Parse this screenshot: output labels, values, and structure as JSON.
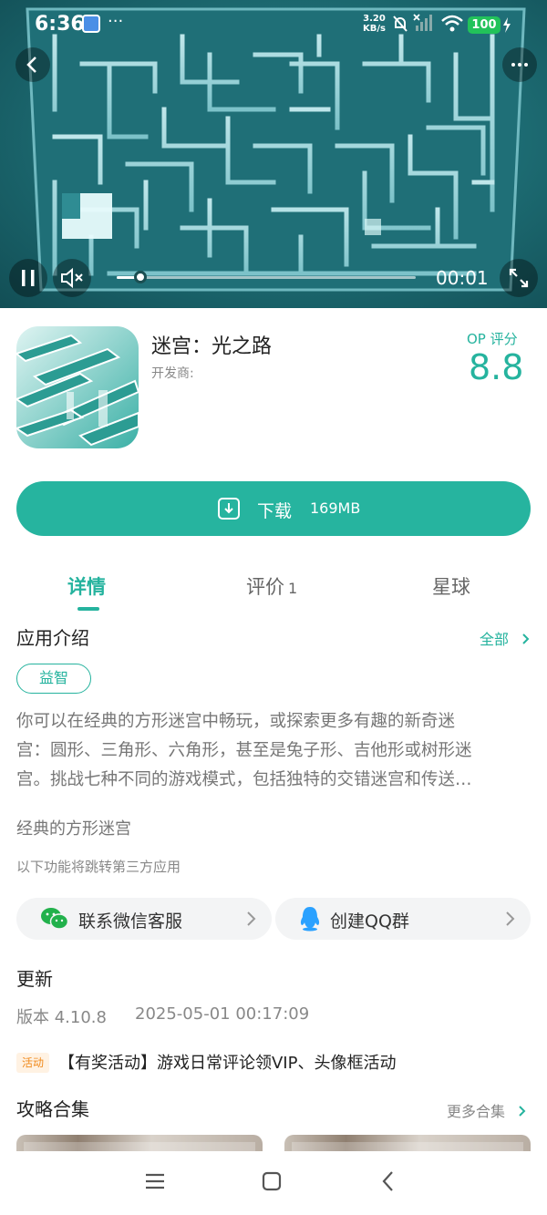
{
  "status_bar": {
    "time": "6:36",
    "net_speed_value": "3.20",
    "net_speed_unit": "KB/s",
    "battery": "100",
    "dots": "···"
  },
  "video": {
    "elapsed": "00:01",
    "progress": 0.08
  },
  "app": {
    "title": "迷宫：光之路",
    "developer_label": "开发商:",
    "op_label": "OP 评分",
    "op_score": "8.8"
  },
  "download": {
    "label": "下载",
    "size": "169MB"
  },
  "tabs": [
    {
      "label": "详情",
      "active": true
    },
    {
      "label": "评价",
      "count": "1"
    },
    {
      "label": "星球"
    }
  ],
  "intro": {
    "title": "应用介绍",
    "all_link": "全部",
    "tag": "益智",
    "description_lines": [
      "你可以在经典的方形迷宫中畅玩，或探索更多有趣的新奇迷",
      "宫：圆形、三角形、六角形，甚至是兔子形、吉他形或树形迷",
      "宫。挑战七种不同的游戏模式，包括独特的交错迷宫和传送…"
    ],
    "subtitle": "经典的方形迷宫",
    "third_party_note": "以下功能将跳转第三方应用"
  },
  "services": [
    {
      "label": "联系微信客服",
      "icon": "wechat-icon"
    },
    {
      "label": "创建QQ群",
      "icon": "qq-icon"
    }
  ],
  "update": {
    "title": "更新",
    "version": "版本 4.10.8",
    "date": "2025-05-01 00:17:09"
  },
  "activity": {
    "badge": "活动",
    "text": "【有奖活动】游戏日常评论领VIP、头像框活动"
  },
  "guides": {
    "title": "攻略合集",
    "more_link": "更多合集"
  },
  "colors": {
    "accent": "#26b49f",
    "activity": "#f08a1c"
  }
}
